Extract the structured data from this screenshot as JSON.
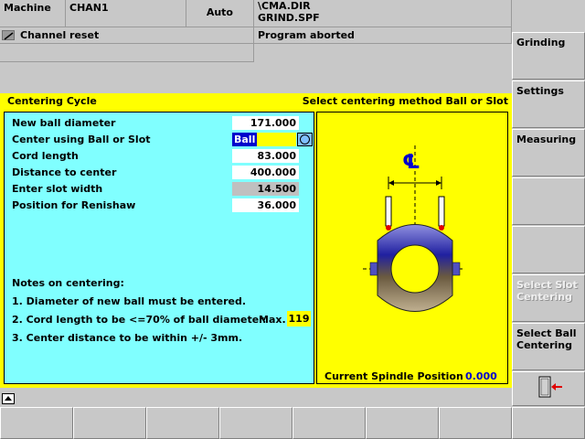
{
  "header": {
    "area": "Machine",
    "channel": "CHAN1",
    "mode": "Auto",
    "program_path": "\\CMA.DIR",
    "program_file": "GRIND.SPF",
    "channel_status": "Channel reset",
    "program_status": "Program aborted"
  },
  "dialog": {
    "title": "Centering Cycle",
    "hint": "Select centering method Ball or Slot",
    "fields": [
      {
        "label": "New ball diameter",
        "value": "171.000"
      },
      {
        "label": "Center using Ball or Slot",
        "value": "Ball"
      },
      {
        "label": "Cord length",
        "value": "83.000"
      },
      {
        "label": "Distance to center",
        "value": "400.000"
      },
      {
        "label": "Enter slot width",
        "value": "14.500"
      },
      {
        "label": "Position for Renishaw",
        "value": "36.000"
      }
    ],
    "notes_title": "Notes on centering:",
    "notes": [
      "1. Diameter of new ball must be entered.",
      "2. Cord length to be <=70% of ball diameter.",
      "3. Center distance to be within +/- 3mm."
    ],
    "max_label": "Max.",
    "max_value": "119",
    "spindle_label": "Current Spindle Position",
    "spindle_value": "0.000",
    "centerline_symbol": "℄"
  },
  "softkeys_right": [
    {
      "label": "Grinding",
      "enabled": true
    },
    {
      "label": "Settings",
      "enabled": true
    },
    {
      "label": "Measuring",
      "enabled": true
    },
    {
      "label": "",
      "enabled": true
    },
    {
      "label": "",
      "enabled": true
    },
    {
      "label": "Select Slot Centering",
      "enabled": false
    },
    {
      "label": "Select Ball Centering",
      "enabled": true
    },
    {
      "label": "",
      "enabled": true
    }
  ],
  "colors": {
    "dialog_border": "#ffff00",
    "form_bg": "#80ffff",
    "graphic_bg": "#ffff00",
    "selected_field": "#ffff00",
    "disabled_field": "#c0c0c0",
    "value_highlight": "#0000cc"
  }
}
